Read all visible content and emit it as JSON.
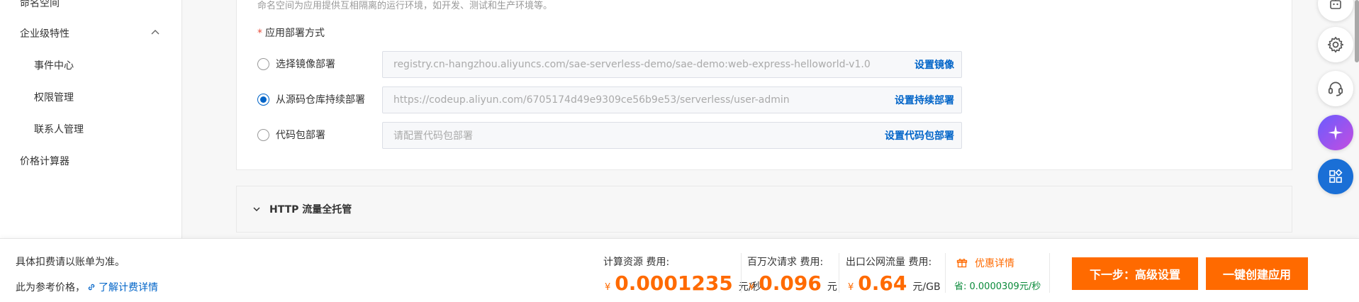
{
  "sidebar": {
    "items": [
      {
        "label": "命名空间"
      },
      {
        "label": "企业级特性"
      },
      {
        "label": "事件中心"
      },
      {
        "label": "权限管理"
      },
      {
        "label": "联系人管理"
      },
      {
        "label": "价格计算器"
      }
    ]
  },
  "form": {
    "note": "命名空间为应用提供互相隔离的运行环境，如开发、测试和生产环境等。",
    "required_mark": "*",
    "deploy_label": "应用部署方式",
    "options": [
      {
        "label": "选择镜像部署",
        "value": "registry.cn-hangzhou.aliyuncs.com/sae-serverless-demo/sae-demo:web-express-helloworld-v1.0",
        "action": "设置镜像",
        "checked": false
      },
      {
        "label": "从源码仓库持续部署",
        "value": "https://codeup.aliyun.com/6705174d49e9309ce56b9e53/serverless/user-admin",
        "action": "设置持续部署",
        "checked": true
      },
      {
        "label": "代码包部署",
        "placeholder": "请配置代码包部署",
        "action": "设置代码包部署",
        "checked": false
      }
    ],
    "section_title": "HTTP 流量全托管"
  },
  "footer": {
    "note1": "具体扣费请以账单为准。",
    "note2": "此为参考价格，",
    "link": "了解计费详情",
    "costs": [
      {
        "label": "计算资源 费用:",
        "symbol": "¥",
        "value": "0.0001235",
        "unit": "元/秒"
      },
      {
        "label": "百万次请求 费用:",
        "symbol": "¥",
        "value": "0.096",
        "unit": "元"
      },
      {
        "label": "出口公网流量 费用:",
        "symbol": "¥",
        "value": "0.64",
        "unit": "元/GB"
      }
    ],
    "promo": "优惠详情",
    "saved": "省: 0.0000309元/秒",
    "next_button": "下一步：高级设置",
    "create_button": "一键创建应用"
  },
  "colors": {
    "accent": "#0064c8",
    "orange": "#ff6a00",
    "green": "#0a8a3a"
  }
}
